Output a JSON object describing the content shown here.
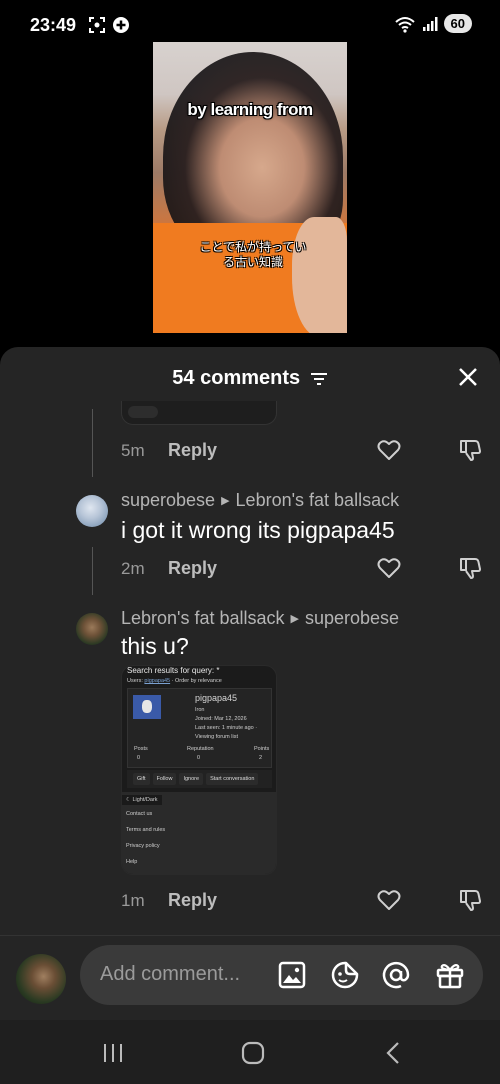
{
  "status_bar": {
    "time": "23:49",
    "battery": "60"
  },
  "video": {
    "caption_en": "by learning from",
    "caption_jp_line1": "ことで私が持ってい",
    "caption_jp_line2": "る古い知識"
  },
  "comments_sheet": {
    "title": "54 comments",
    "prev_reply": {
      "time": "5m",
      "reply_label": "Reply"
    },
    "comments": [
      {
        "author": "superobese",
        "reply_to": "Lebron's fat ballsack",
        "text": "i got it wrong its pigpapa45",
        "time": "2m",
        "reply_label": "Reply"
      },
      {
        "author": "Lebron's fat ballsack",
        "reply_to": "superobese",
        "text": "this u?",
        "time": "1m",
        "reply_label": "Reply"
      }
    ],
    "attachment": {
      "search_title": "Search results for query: *",
      "users_label": "Users:",
      "users_link": "pigpapa45",
      "users_order": "· Order by relevance",
      "username": "pigpapa45",
      "rank": "Iron",
      "joined": "Joined: Mar 12, 2026",
      "last_seen": "Last seen: 1 minute ago ·",
      "viewing": "Viewing forum list",
      "posts_label": "Posts",
      "posts_value": "0",
      "reputation_label": "Reputation",
      "reputation_value": "0",
      "points_label": "Points",
      "points_value": "2",
      "buttons": [
        "Gift",
        "Follow",
        "Ignore",
        "Start conversation"
      ],
      "menu": [
        "☾ Light/Dark",
        "Contact us",
        "Terms and rules",
        "Privacy policy",
        "Help"
      ]
    }
  },
  "input": {
    "placeholder": "Add comment..."
  },
  "colors": {
    "sheet_bg": "#252525",
    "input_bg": "#3a3a3a",
    "muted_text": "#9a9a9a"
  }
}
